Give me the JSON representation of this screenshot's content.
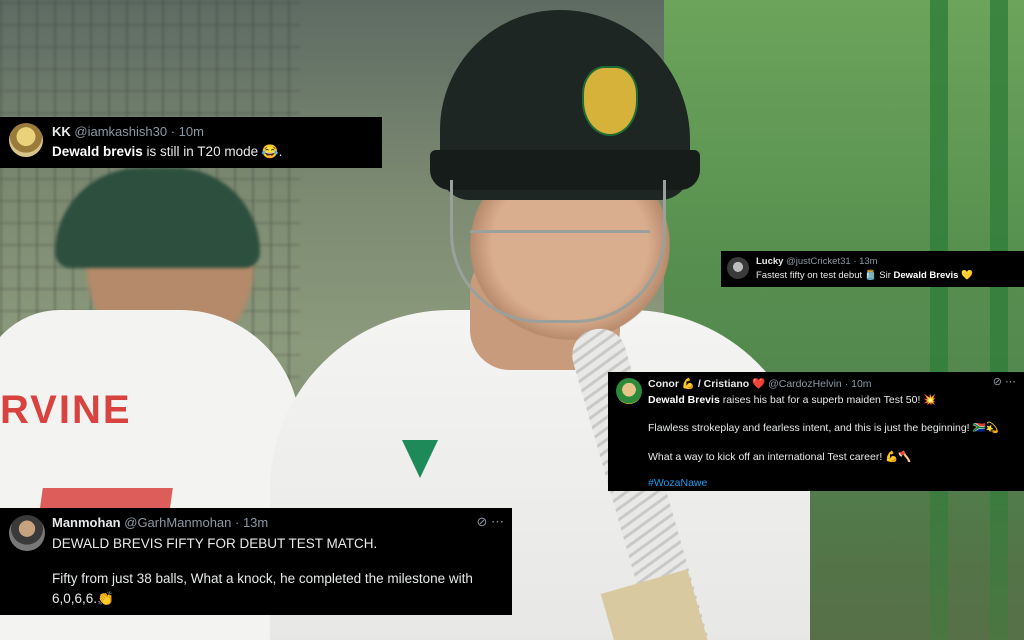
{
  "background": {
    "jersey_name": "RVINE"
  },
  "tweets": {
    "kk": {
      "name": "KK",
      "handle": "@iamkashish30",
      "time": "· 10m",
      "bold": "Dewald brevis",
      "text": " is still in T20 mode 😂."
    },
    "lucky": {
      "name": "Lucky",
      "handle": "@justCricket31",
      "time": "· 13m",
      "text": "Fastest fifty on test debut 🫙 Sir ",
      "bold": "Dewald Brevis",
      "emoji": " 💛"
    },
    "conor": {
      "name": "Conor 💪 / Cristiano ❤️",
      "handle": "@CardozHelvin",
      "time": "· 10m",
      "bold": "Dewald Brevis",
      "line1": " raises his bat for a superb maiden Test 50! 💥",
      "line2": "Flawless strokeplay and fearless intent, and this is just the beginning! 🇿🇦💫",
      "line3": "What a way to kick off an international Test career! 💪🪓",
      "hashtag": "#WozaNawe",
      "icon_grok": "⊘",
      "icon_more": "⋯"
    },
    "manmohan": {
      "name": "Manmohan",
      "handle": "@GarhManmohan",
      "time": "· 13m",
      "line1": "DEWALD BREVIS FIFTY FOR DEBUT TEST MATCH.",
      "line2": "Fifty from just 38 balls, What a knock, he completed the milestone with",
      "line3": "6,0,6,6.👏",
      "icon_grok": "⊘",
      "icon_more": "⋯"
    }
  }
}
